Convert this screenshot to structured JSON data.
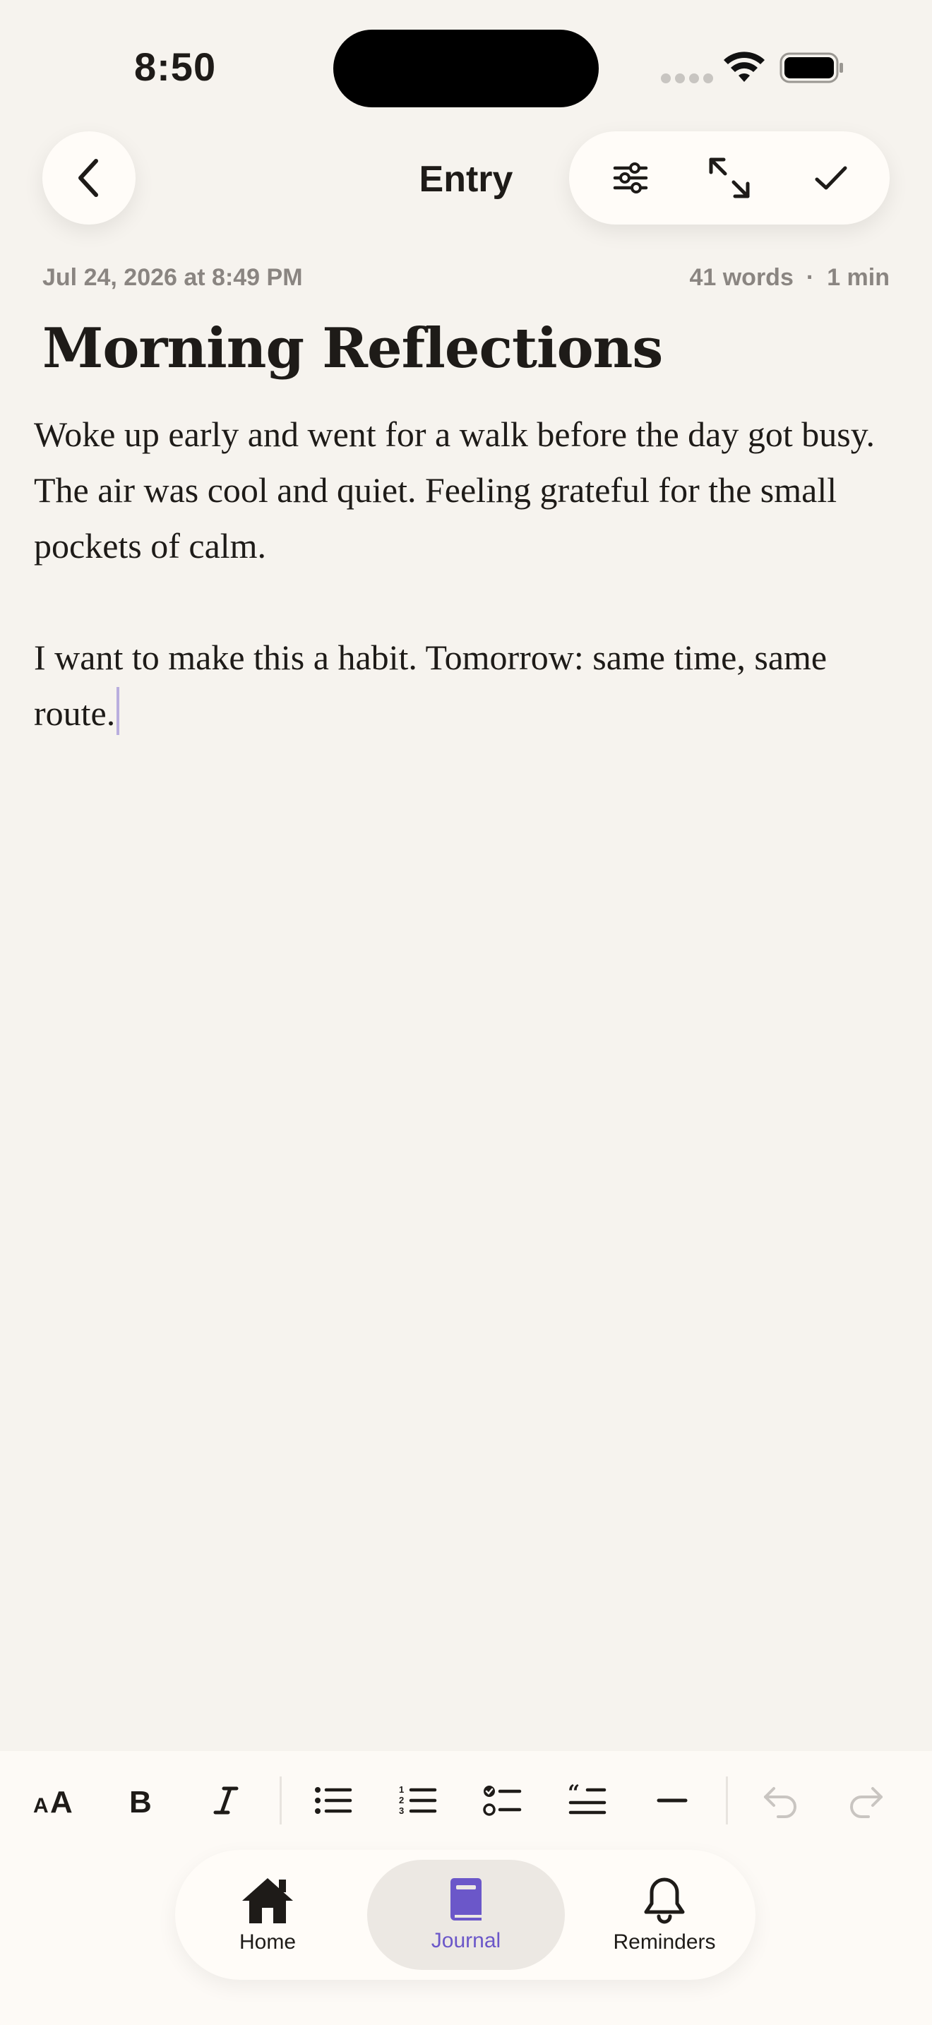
{
  "status_bar": {
    "time": "8:50"
  },
  "nav": {
    "title": "Entry"
  },
  "entry": {
    "date": "Jul 24, 2026 at 8:49 PM",
    "word_count": "41 words",
    "separator": "·",
    "read_time": "1 min",
    "title": "Morning Reflections",
    "paragraphs": [
      "Woke up early and went for a walk before the day got busy. The air was cool and quiet. Feeling grateful for the small pockets of calm.",
      "I want to make this a habit. Tomorrow: same time, same route."
    ]
  },
  "toolbar": {
    "items": [
      "text-size-icon",
      "bold-icon",
      "italic-icon",
      "bullet-list-icon",
      "numbered-list-icon",
      "checklist-icon",
      "quote-icon",
      "divider-icon",
      "undo-icon",
      "redo-icon"
    ]
  },
  "tabbar": {
    "tabs": [
      {
        "label": "Home",
        "icon": "house-icon"
      },
      {
        "label": "Journal",
        "icon": "journal-icon",
        "active": true
      },
      {
        "label": "Reminders",
        "icon": "bell-icon"
      }
    ]
  },
  "colors": {
    "background": "#f6f3ee",
    "accent": "#6b57c9",
    "text": "#1e1b18",
    "muted": "#8a8581"
  }
}
